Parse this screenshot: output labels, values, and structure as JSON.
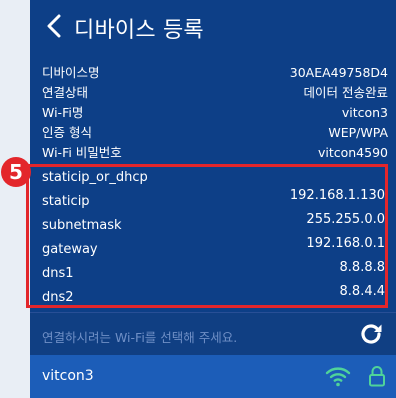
{
  "header": {
    "title": "디바이스 등록"
  },
  "device_info": [
    {
      "label": "디바이스명",
      "value": "30AEA49758D4"
    },
    {
      "label": "연결상태",
      "value": "데이터 전송완료"
    },
    {
      "label": "Wi-Fi명",
      "value": "vitcon3"
    },
    {
      "label": "인증 형식",
      "value": "WEP/WPA"
    },
    {
      "label": "Wi-Fi 비밀번호",
      "value": "vitcon4590"
    }
  ],
  "network": [
    {
      "label": "staticip_or_dhcp",
      "value": ""
    },
    {
      "label": "staticip",
      "value": "192.168.1.130"
    },
    {
      "label": "subnetmask",
      "value": "255.255.0.0"
    },
    {
      "label": "gateway",
      "value": "192.168.0.1"
    },
    {
      "label": "dns1",
      "value": "8.8.8.8"
    },
    {
      "label": "dns2",
      "value": "8.8.4.4"
    }
  ],
  "annotation": {
    "badge": "5",
    "color": "#e3262b"
  },
  "wifi_select": {
    "prompt": "연결하시려는 Wi-Fi를 선택해 주세요."
  },
  "wifi_list": [
    {
      "ssid": "vitcon3"
    }
  ],
  "colors": {
    "background": "#0d3f87",
    "accent": "#4fd39a",
    "selected_row": "#1c5db8"
  }
}
